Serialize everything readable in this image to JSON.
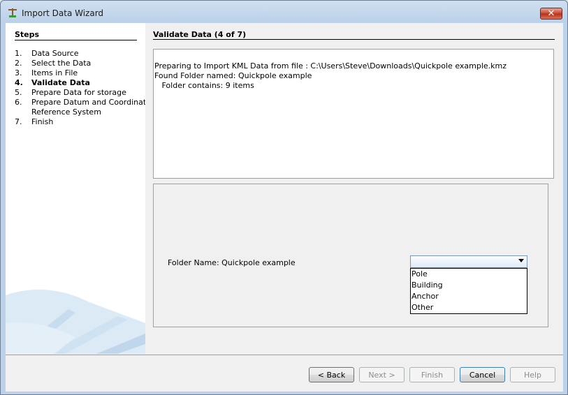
{
  "window": {
    "title": "Import Data Wizard"
  },
  "steps": {
    "title": "Steps",
    "items": [
      {
        "num": "1.",
        "label": "Data Source"
      },
      {
        "num": "2.",
        "label": "Select the Data"
      },
      {
        "num": "3.",
        "label": "Items in File"
      },
      {
        "num": "4.",
        "label": "Validate Data"
      },
      {
        "num": "5.",
        "label": "Prepare Data for storage"
      },
      {
        "num": "6.",
        "label": "Prepare Datum and Coordinate"
      },
      {
        "num": "",
        "label": "Reference System"
      },
      {
        "num": "7.",
        "label": "Finish"
      }
    ]
  },
  "main": {
    "title": "Validate Data (4 of 7)",
    "log": [
      "Preparing to Import KML Data from file : C:\\Users\\Steve\\Downloads\\Quickpole example.kmz",
      "Found Folder named: Quickpole example",
      "   Folder contains: 9 items"
    ],
    "folder_label": "Folder Name: Quickpole example",
    "combo_value": "",
    "options": [
      "Pole",
      "Building",
      "Anchor",
      "Other"
    ]
  },
  "buttons": {
    "back": "< Back",
    "next": "Next >",
    "finish": "Finish",
    "cancel": "Cancel",
    "help": "Help"
  }
}
